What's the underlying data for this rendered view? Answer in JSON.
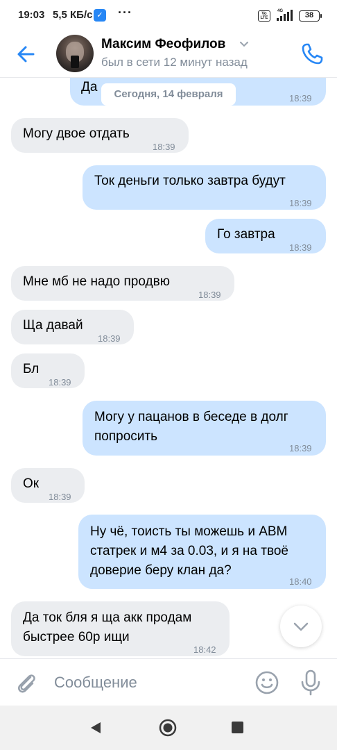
{
  "status_bar": {
    "time": "19:03",
    "speed": "5,5 КБ/с",
    "app_icon": "vk-icon",
    "dots": "···",
    "volte": "Vo LTE",
    "network": "4G",
    "battery": "38"
  },
  "header": {
    "name": "Максим Феофилов",
    "status": "был в сети 12 минут назад",
    "back_icon": "arrow-left-icon",
    "call_icon": "phone-icon"
  },
  "chat": {
    "date_separator": "Сегодня, 14 февраля",
    "messages": [
      {
        "dir": "out",
        "text": "Да",
        "time": "18:39"
      },
      {
        "dir": "in",
        "text": "Могу двое отдать",
        "time": "18:39"
      },
      {
        "dir": "out",
        "text": "Ток деньги только завтра будут",
        "time": "18:39"
      },
      {
        "dir": "out",
        "text": "Го завтра",
        "time": "18:39"
      },
      {
        "dir": "in",
        "text": "Мне мб не надо продвю",
        "time": "18:39"
      },
      {
        "dir": "in",
        "text": "Ща давай",
        "time": "18:39"
      },
      {
        "dir": "in",
        "text": "Бл",
        "time": "18:39"
      },
      {
        "dir": "out",
        "text_lines": [
          "Могу у пацанов в беседе в долг",
          "попросить"
        ],
        "time": "18:39"
      },
      {
        "dir": "in",
        "text": "Ок",
        "time": "18:39"
      },
      {
        "dir": "out",
        "text_lines": [
          "Ну чё, тоисть ты можешь и ABM",
          "статрек и м4 за 0.03, и я на твоё",
          "доверие беру клан да?"
        ],
        "time": "18:40"
      },
      {
        "dir": "in",
        "text_lines": [
          "Да ток бля я ща акк продам",
          "быстрее 60р ищи"
        ],
        "time": "18:42"
      }
    ]
  },
  "composer": {
    "placeholder": "Сообщение",
    "value": ""
  },
  "colors": {
    "accent": "#2787f5",
    "incoming_bubble": "#ebedf0",
    "outgoing_bubble": "#cce4ff",
    "secondary_text": "#818c99"
  }
}
